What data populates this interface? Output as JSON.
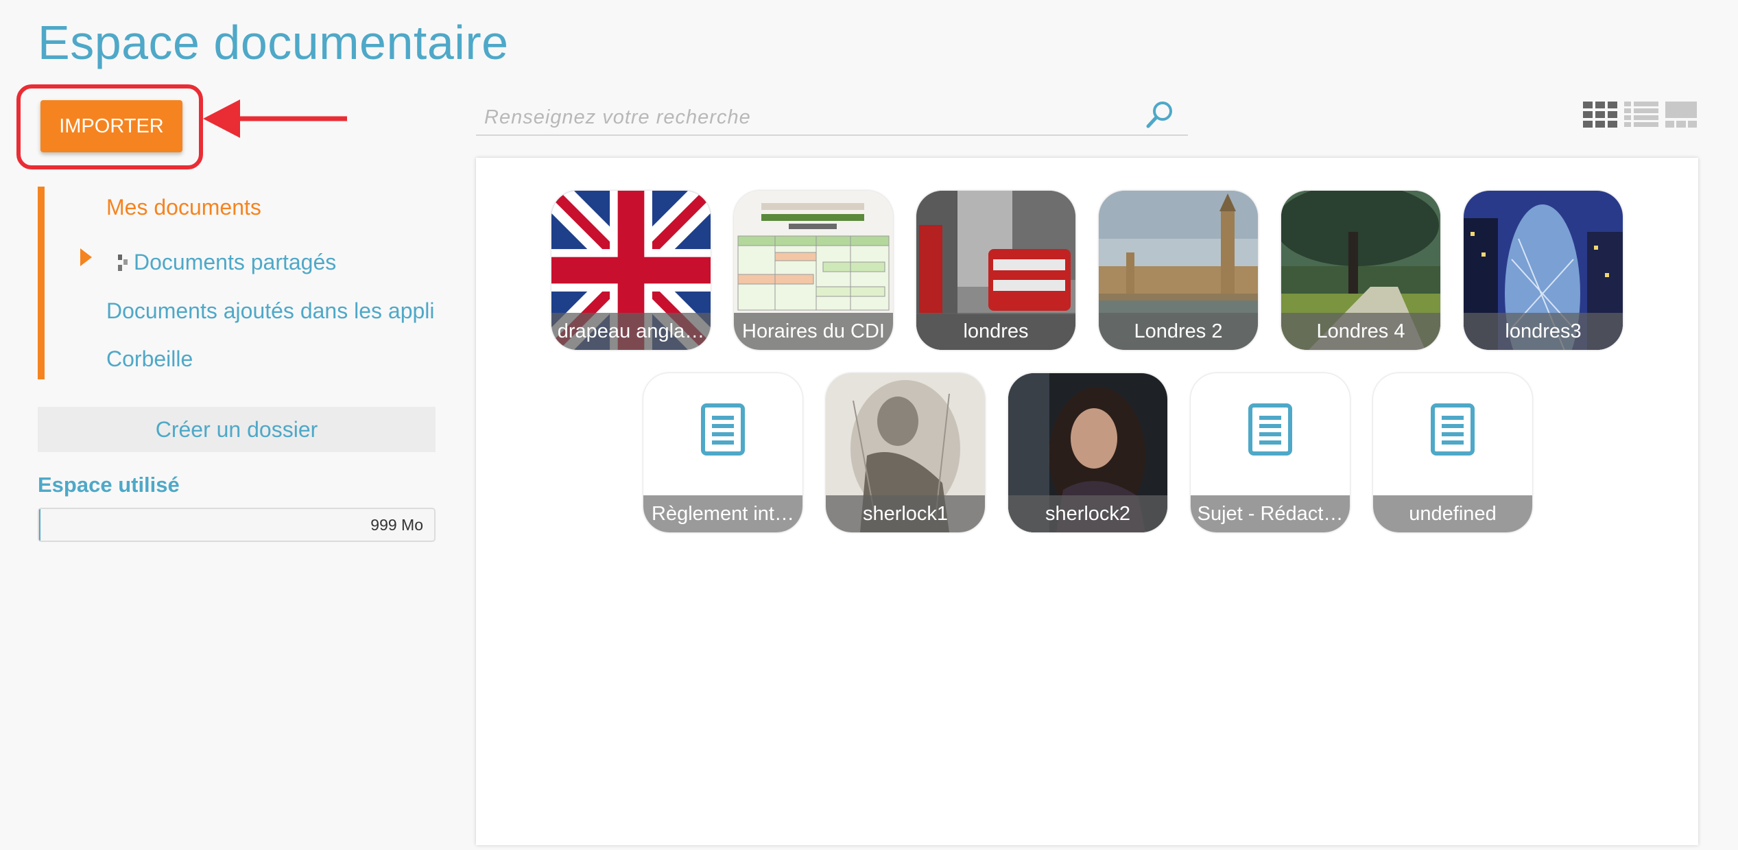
{
  "page": {
    "title": "Espace documentaire"
  },
  "toolbar": {
    "import_label": "IMPORTER"
  },
  "sidebar": {
    "items": [
      {
        "label": "Mes documents",
        "active": true
      },
      {
        "label": "Documents partagés",
        "active": false
      },
      {
        "label": "Documents ajoutés dans les appli",
        "active": false
      },
      {
        "label": "Corbeille",
        "active": false
      }
    ],
    "create_folder_label": "Créer un dossier",
    "storage": {
      "label": "Espace utilisé",
      "value_text": "999 Mo",
      "fill_fraction": 0.004
    }
  },
  "search": {
    "placeholder": "Renseignez votre recherche"
  },
  "views": [
    "grid-view-icon",
    "list-view-icon",
    "carousel-view-icon"
  ],
  "files": [
    {
      "name": "drapeau angla…",
      "kind": "image"
    },
    {
      "name": "Horaires du CDI",
      "kind": "image"
    },
    {
      "name": "londres",
      "kind": "image"
    },
    {
      "name": "Londres 2",
      "kind": "image"
    },
    {
      "name": "Londres 4",
      "kind": "image"
    },
    {
      "name": "londres3",
      "kind": "image"
    },
    {
      "name": "Règlement int…",
      "kind": "document"
    },
    {
      "name": "sherlock1",
      "kind": "image"
    },
    {
      "name": "sherlock2",
      "kind": "image"
    },
    {
      "name": "Sujet - Rédact…",
      "kind": "document"
    },
    {
      "name": "undefined",
      "kind": "document"
    }
  ],
  "colors": {
    "accent": "#f58420",
    "primary": "#4ea8c8",
    "highlight": "#ea2c34"
  }
}
